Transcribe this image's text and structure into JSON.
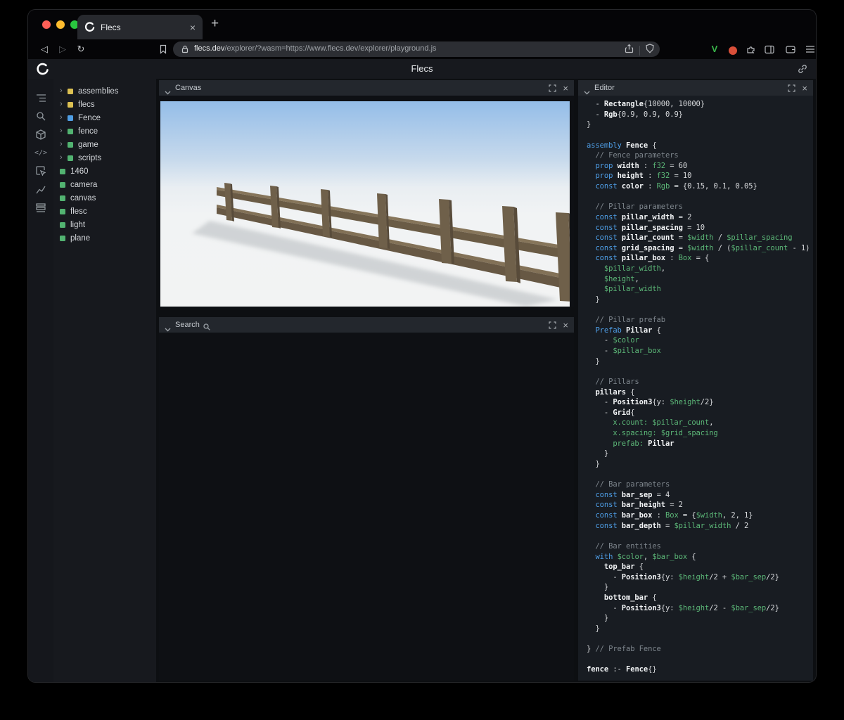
{
  "glyphs": {
    "tab_close": "×",
    "new_tab": "+",
    "panel_close": "×",
    "back": "◁",
    "forward": "▷",
    "reload": "↻"
  },
  "colors": {
    "traffic_red": "#ff5f57",
    "traffic_yellow": "#febc2e",
    "traffic_green": "#29c73f",
    "keyword_blue": "#4f9fe8",
    "type_green": "#5cb878",
    "comment_gray": "#7e868d",
    "square_yellow": "#dcc052",
    "square_blue": "#4f9ee4",
    "square_green": "#52b371",
    "ext_v_green": "#39b54a",
    "ext_red": "#d94f39"
  },
  "browser": {
    "tab_title": "Flecs",
    "url_domain": "flecs.dev",
    "url_path": "/explorer/?wasm=https://www.flecs.dev/explorer/playground.js",
    "toolbar_icon_names": [
      "back-icon",
      "forward-icon",
      "reload-icon",
      "bookmark-icon",
      "lock-icon",
      "share-icon",
      "shield-icon",
      "v-extension-icon",
      "red-extension-icon",
      "puzzle-icon",
      "side-panel-icon",
      "wallet-icon",
      "menu-icon"
    ]
  },
  "app": {
    "title": "Flecs"
  },
  "sidebar_icon_names": [
    "hierarchy-icon",
    "search-icon",
    "cube-icon",
    "code-icon",
    "inspect-icon",
    "chart-icon",
    "rows-icon"
  ],
  "tree": {
    "items": [
      {
        "label": "assemblies",
        "color": "#dcc052",
        "expandable": true
      },
      {
        "label": "flecs",
        "color": "#dcc052",
        "expandable": true
      },
      {
        "label": "Fence",
        "color": "#4f9ee4",
        "expandable": true
      },
      {
        "label": "fence",
        "color": "#52b371",
        "expandable": true
      },
      {
        "label": "game",
        "color": "#52b371",
        "expandable": true
      },
      {
        "label": "scripts",
        "color": "#52b371",
        "expandable": true
      },
      {
        "label": "1460",
        "color": "#52b371",
        "expandable": false
      },
      {
        "label": "camera",
        "color": "#52b371",
        "expandable": false
      },
      {
        "label": "canvas",
        "color": "#52b371",
        "expandable": false
      },
      {
        "label": "flesc",
        "color": "#52b371",
        "expandable": false
      },
      {
        "label": "light",
        "color": "#52b371",
        "expandable": false
      },
      {
        "label": "plane",
        "color": "#52b371",
        "expandable": false
      }
    ]
  },
  "panels": {
    "canvas": {
      "title": "Canvas"
    },
    "search": {
      "title": "Search"
    },
    "editor": {
      "title": "Editor"
    }
  },
  "editor": {
    "lines": [
      [
        [
          "p",
          "  - "
        ],
        [
          "b",
          "Rectangle"
        ],
        [
          "p",
          "{10000, 10000}"
        ]
      ],
      [
        [
          "p",
          "  - "
        ],
        [
          "b",
          "Rgb"
        ],
        [
          "p",
          "{0.9, 0.9, 0.9}"
        ]
      ],
      [
        [
          "p",
          "}"
        ]
      ],
      [],
      [
        [
          "k",
          "assembly "
        ],
        [
          "b",
          "Fence "
        ],
        [
          "p",
          "{"
        ]
      ],
      [
        [
          "c",
          "  // Fence parameters"
        ]
      ],
      [
        [
          "k",
          "  prop "
        ],
        [
          "b",
          "width"
        ],
        [
          "p",
          " : "
        ],
        [
          "t",
          "f32"
        ],
        [
          "p",
          " = 60"
        ]
      ],
      [
        [
          "k",
          "  prop "
        ],
        [
          "b",
          "height"
        ],
        [
          "p",
          " : "
        ],
        [
          "t",
          "f32"
        ],
        [
          "p",
          " = 10"
        ]
      ],
      [
        [
          "k",
          "  const "
        ],
        [
          "b",
          "color"
        ],
        [
          "p",
          " : "
        ],
        [
          "t",
          "Rgb"
        ],
        [
          "p",
          " = {0.15, 0.1, 0.05}"
        ]
      ],
      [],
      [
        [
          "c",
          "  // Pillar parameters"
        ]
      ],
      [
        [
          "k",
          "  const "
        ],
        [
          "b",
          "pillar_width"
        ],
        [
          "p",
          " = 2"
        ]
      ],
      [
        [
          "k",
          "  const "
        ],
        [
          "b",
          "pillar_spacing"
        ],
        [
          "p",
          " = 10"
        ]
      ],
      [
        [
          "k",
          "  const "
        ],
        [
          "b",
          "pillar_count"
        ],
        [
          "p",
          " = "
        ],
        [
          "v",
          "$width"
        ],
        [
          "p",
          " / "
        ],
        [
          "v",
          "$pillar_spacing"
        ]
      ],
      [
        [
          "k",
          "  const "
        ],
        [
          "b",
          "grid_spacing"
        ],
        [
          "p",
          " = "
        ],
        [
          "v",
          "$width"
        ],
        [
          "p",
          " / ("
        ],
        [
          "v",
          "$pillar_count"
        ],
        [
          "p",
          " - 1)"
        ]
      ],
      [
        [
          "k",
          "  const "
        ],
        [
          "b",
          "pillar_box"
        ],
        [
          "p",
          " : "
        ],
        [
          "t",
          "Box"
        ],
        [
          "p",
          " = {"
        ]
      ],
      [
        [
          "v",
          "    $pillar_width"
        ],
        [
          "p",
          ","
        ]
      ],
      [
        [
          "v",
          "    $height"
        ],
        [
          "p",
          ","
        ]
      ],
      [
        [
          "v",
          "    $pillar_width"
        ]
      ],
      [
        [
          "p",
          "  }"
        ]
      ],
      [],
      [
        [
          "c",
          "  // Pillar prefab"
        ]
      ],
      [
        [
          "k",
          "  Prefab "
        ],
        [
          "b",
          "Pillar "
        ],
        [
          "p",
          "{"
        ]
      ],
      [
        [
          "p",
          "    - "
        ],
        [
          "v",
          "$color"
        ]
      ],
      [
        [
          "p",
          "    - "
        ],
        [
          "v",
          "$pillar_box"
        ]
      ],
      [
        [
          "p",
          "  }"
        ]
      ],
      [],
      [
        [
          "c",
          "  // Pillars"
        ]
      ],
      [
        [
          "b",
          "  pillars "
        ],
        [
          "p",
          "{"
        ]
      ],
      [
        [
          "p",
          "    - "
        ],
        [
          "b",
          "Position3"
        ],
        [
          "p",
          "{y: "
        ],
        [
          "v",
          "$height"
        ],
        [
          "p",
          "/2}"
        ]
      ],
      [
        [
          "p",
          "    - "
        ],
        [
          "b",
          "Grid"
        ],
        [
          "p",
          "{"
        ]
      ],
      [
        [
          "v",
          "      x.count: $pillar_count"
        ],
        [
          "p",
          ","
        ]
      ],
      [
        [
          "v",
          "      x.spacing: $grid_spacing"
        ]
      ],
      [
        [
          "v",
          "      prefab: "
        ],
        [
          "b",
          "Pillar"
        ]
      ],
      [
        [
          "p",
          "    }"
        ]
      ],
      [
        [
          "p",
          "  }"
        ]
      ],
      [],
      [
        [
          "c",
          "  // Bar parameters"
        ]
      ],
      [
        [
          "k",
          "  const "
        ],
        [
          "b",
          "bar_sep"
        ],
        [
          "p",
          " = 4"
        ]
      ],
      [
        [
          "k",
          "  const "
        ],
        [
          "b",
          "bar_height"
        ],
        [
          "p",
          " = 2"
        ]
      ],
      [
        [
          "k",
          "  const "
        ],
        [
          "b",
          "bar_box"
        ],
        [
          "p",
          " : "
        ],
        [
          "t",
          "Box"
        ],
        [
          "p",
          " = {"
        ],
        [
          "v",
          "$width"
        ],
        [
          "p",
          ", 2, 1}"
        ]
      ],
      [
        [
          "k",
          "  const "
        ],
        [
          "b",
          "bar_depth"
        ],
        [
          "p",
          " = "
        ],
        [
          "v",
          "$pillar_width"
        ],
        [
          "p",
          " / 2"
        ]
      ],
      [],
      [
        [
          "c",
          "  // Bar entities"
        ]
      ],
      [
        [
          "k",
          "  with "
        ],
        [
          "v",
          "$color"
        ],
        [
          "p",
          ", "
        ],
        [
          "v",
          "$bar_box"
        ],
        [
          "p",
          " {"
        ]
      ],
      [
        [
          "b",
          "    top_bar "
        ],
        [
          "p",
          "{"
        ]
      ],
      [
        [
          "p",
          "      - "
        ],
        [
          "b",
          "Position3"
        ],
        [
          "p",
          "{y: "
        ],
        [
          "v",
          "$height"
        ],
        [
          "p",
          "/2 + "
        ],
        [
          "v",
          "$bar_sep"
        ],
        [
          "p",
          "/2}"
        ]
      ],
      [
        [
          "p",
          "    }"
        ]
      ],
      [
        [
          "b",
          "    bottom_bar "
        ],
        [
          "p",
          "{"
        ]
      ],
      [
        [
          "p",
          "      - "
        ],
        [
          "b",
          "Position3"
        ],
        [
          "p",
          "{y: "
        ],
        [
          "v",
          "$height"
        ],
        [
          "p",
          "/2 - "
        ],
        [
          "v",
          "$bar_sep"
        ],
        [
          "p",
          "/2}"
        ]
      ],
      [
        [
          "p",
          "    }"
        ]
      ],
      [
        [
          "p",
          "  }"
        ]
      ],
      [],
      [
        [
          "p",
          "} "
        ],
        [
          "c",
          "// Prefab Fence"
        ]
      ],
      [],
      [
        [
          "b",
          "fence"
        ],
        [
          "p",
          " :- "
        ],
        [
          "b",
          "Fence"
        ],
        [
          "p",
          "{}"
        ]
      ]
    ]
  }
}
